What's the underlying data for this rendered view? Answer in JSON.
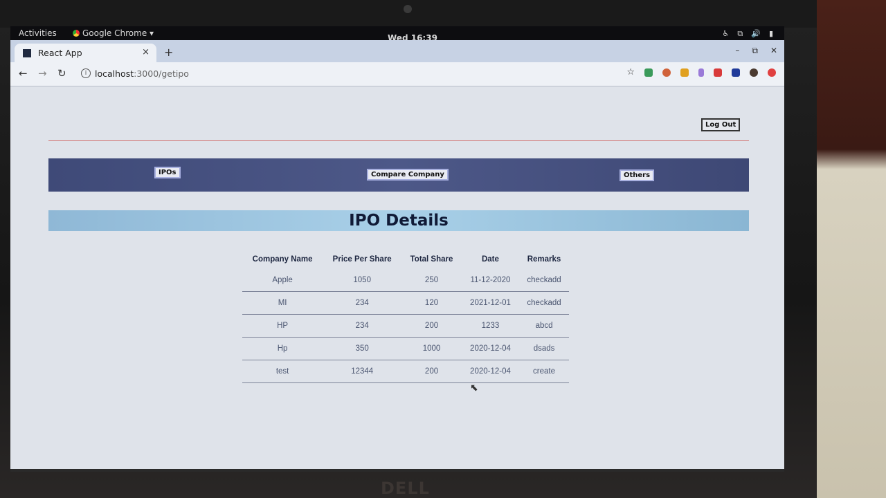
{
  "system_bar": {
    "activities": "Activities",
    "app_menu": "Google Chrome ▾",
    "clock": "Wed 16:39"
  },
  "browser": {
    "tab_title": "React App",
    "tab_close": "×",
    "new_tab": "+",
    "url_host": "localhost",
    "url_path": ":3000/getipo",
    "window_controls": [
      "–",
      "⧉",
      "✕"
    ]
  },
  "header": {
    "logout_label": "Log Out"
  },
  "navbar": {
    "ipos_label": "IPOs",
    "compare_label": "Compare Company",
    "others_label": "Others"
  },
  "main": {
    "title": "IPO Details",
    "table": {
      "headers": [
        "Company Name",
        "Price Per Share",
        "Total Share",
        "Date",
        "Remarks"
      ],
      "rows": [
        [
          "Apple",
          "1050",
          "250",
          "11-12-2020",
          "checkadd"
        ],
        [
          "MI",
          "234",
          "120",
          "2021-12-01",
          "checkadd"
        ],
        [
          "HP",
          "234",
          "200",
          "1233",
          "abcd"
        ],
        [
          "Hp",
          "350",
          "1000",
          "2020-12-04",
          "dsads"
        ],
        [
          "test",
          "12344",
          "200",
          "2020-12-04",
          "create"
        ]
      ]
    }
  },
  "device": {
    "brand": "DELL"
  },
  "colors": {
    "navbar_bg": "#46517f",
    "title_bar_bg": "#a0c8e2",
    "page_bg": "#dfe3ea"
  }
}
